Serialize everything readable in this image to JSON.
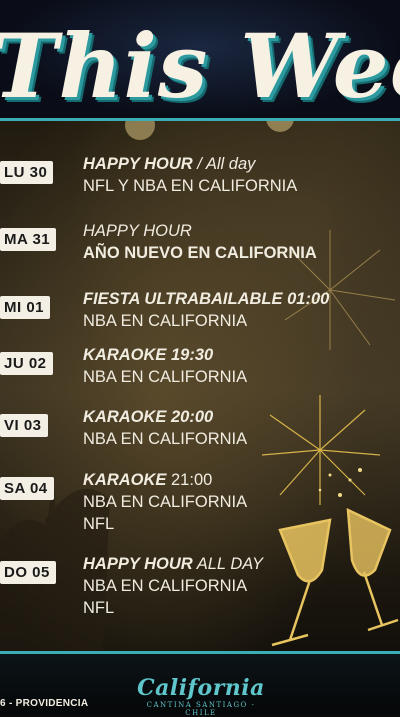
{
  "header": {
    "title": "This Week"
  },
  "events": [
    {
      "day": "LU 30",
      "lines": [
        {
          "parts": [
            {
              "text": "HAPPY HOUR",
              "style": "bi"
            },
            {
              "text": " / All day",
              "style": "it"
            }
          ]
        },
        {
          "parts": [
            {
              "text": "NFL Y NBA EN CALIFORNIA",
              "style": ""
            }
          ]
        }
      ]
    },
    {
      "day": "MA 31",
      "lines": [
        {
          "parts": [
            {
              "text": "HAPPY HOUR",
              "style": "it"
            }
          ]
        },
        {
          "parts": [
            {
              "text": "AÑO NUEVO EN CALIFORNIA",
              "style": "bd"
            }
          ]
        }
      ]
    },
    {
      "day": "MI 01",
      "lines": [
        {
          "parts": [
            {
              "text": "FIESTA ULTRABAILABLE 01:00",
              "style": "bi"
            }
          ]
        },
        {
          "parts": [
            {
              "text": "NBA EN CALIFORNIA",
              "style": ""
            }
          ]
        }
      ]
    },
    {
      "day": "JU 02",
      "lines": [
        {
          "parts": [
            {
              "text": "KARAOKE  19:30",
              "style": "bi"
            }
          ]
        },
        {
          "parts": [
            {
              "text": "NBA EN CALIFORNIA",
              "style": ""
            }
          ]
        }
      ]
    },
    {
      "day": "VI 03",
      "lines": [
        {
          "parts": [
            {
              "text": "KARAOKE 20:00",
              "style": "bi"
            }
          ]
        },
        {
          "parts": [
            {
              "text": "NBA EN CALIFORNIA",
              "style": ""
            }
          ]
        }
      ]
    },
    {
      "day": "SA 04",
      "lines": [
        {
          "parts": [
            {
              "text": "KARAOKE",
              "style": "bi"
            },
            {
              "text": " 21:00",
              "style": ""
            }
          ]
        },
        {
          "parts": [
            {
              "text": "NBA EN CALIFORNIA",
              "style": ""
            }
          ]
        },
        {
          "parts": [
            {
              "text": "NFL",
              "style": ""
            }
          ]
        }
      ]
    },
    {
      "day": "DO 05",
      "lines": [
        {
          "parts": [
            {
              "text": "HAPPY HOUR",
              "style": "bi"
            },
            {
              "text": "  ALL DAY",
              "style": "it"
            }
          ]
        },
        {
          "parts": [
            {
              "text": "NBA EN CALIFORNIA",
              "style": ""
            }
          ]
        },
        {
          "parts": [
            {
              "text": "NFL",
              "style": ""
            }
          ]
        }
      ]
    }
  ],
  "footer": {
    "address": "6 - PROVIDENCIA",
    "logo_name": "California",
    "logo_tagline": "CANTINA  SANTIAGO - CHILE"
  },
  "colors": {
    "accent": "#3aaeb6",
    "tag_bg": "#f3efe4",
    "text": "#f1ece0",
    "gold": "#e8c460"
  }
}
